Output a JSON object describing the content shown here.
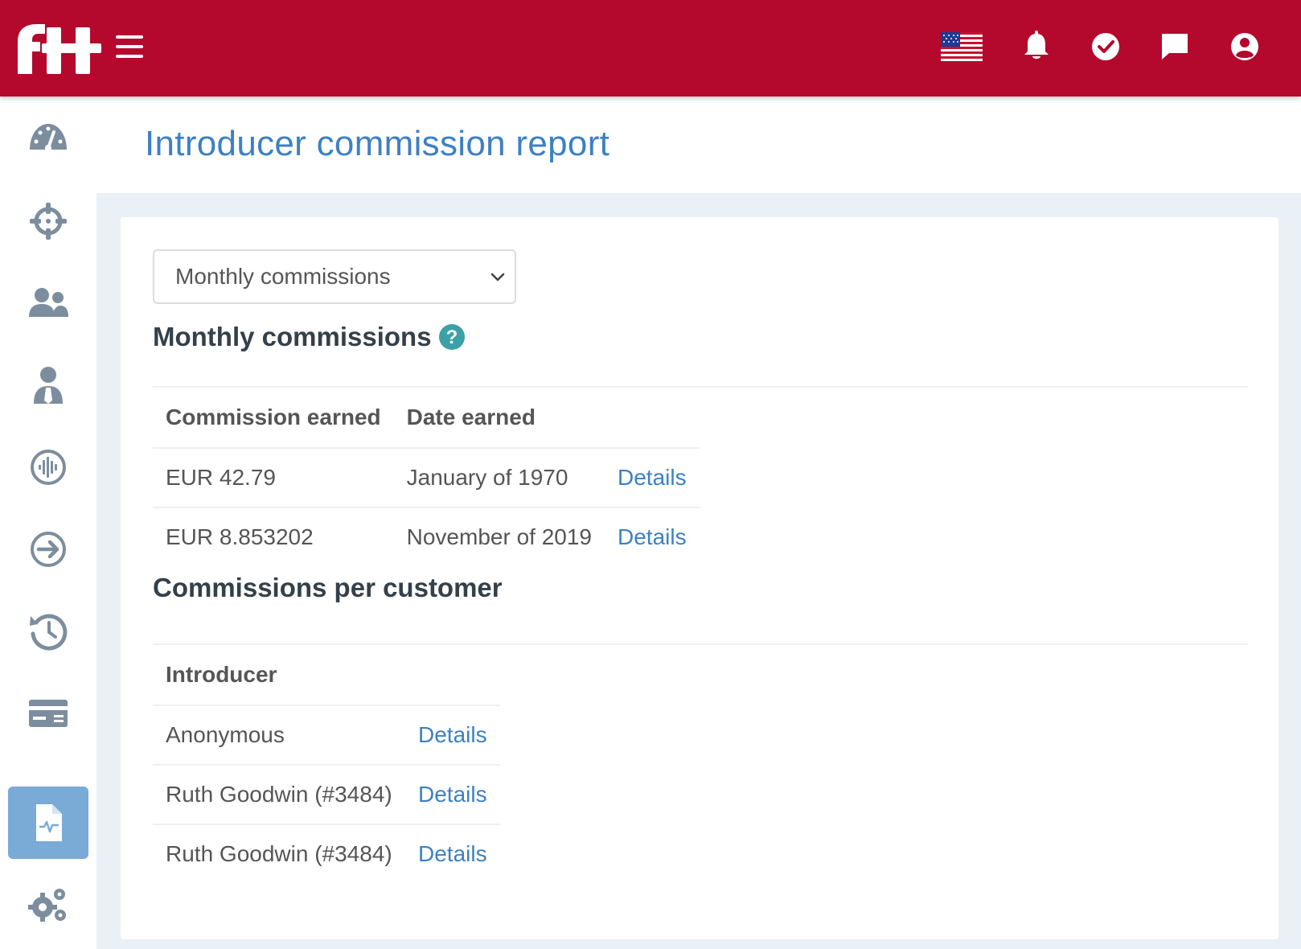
{
  "topbar": {
    "logo_icon": "fh-logo",
    "menu_icon": "hamburger-menu-icon",
    "icons": [
      "us-flag-icon",
      "bell-icon",
      "check-circle-icon",
      "chat-icon",
      "user-circle-icon"
    ],
    "background_color": "#b4082d"
  },
  "sidebar": {
    "items": [
      {
        "icon": "dashboard-gauge-icon",
        "active": false
      },
      {
        "icon": "crosshair-icon",
        "active": false
      },
      {
        "icon": "users-icon",
        "active": false
      },
      {
        "icon": "user-tie-icon",
        "active": false
      },
      {
        "icon": "waveform-circle-icon",
        "active": false
      },
      {
        "icon": "arrow-right-circle-icon",
        "active": false
      },
      {
        "icon": "history-icon",
        "active": false
      },
      {
        "icon": "credit-card-icon",
        "active": false
      },
      {
        "icon": "file-report-icon",
        "active": true
      },
      {
        "icon": "gears-icon",
        "active": false
      }
    ],
    "active_color": "#7aaad6"
  },
  "page": {
    "title": "Introducer commission report"
  },
  "report_select": {
    "selected": "Monthly commissions"
  },
  "monthly": {
    "title": "Monthly commissions",
    "help_icon": "question-circle-icon",
    "headers": [
      "Commission earned",
      "Date earned"
    ],
    "rows": [
      {
        "amount": "EUR 42.79",
        "date": "January of 1970",
        "link": "Details"
      },
      {
        "amount": "EUR 8.853202",
        "date": "November of 2019",
        "link": "Details"
      }
    ]
  },
  "per_customer": {
    "title": "Commissions per customer",
    "headers": [
      "Introducer"
    ],
    "rows": [
      {
        "introducer": "Anonymous",
        "link": "Details"
      },
      {
        "introducer": "Ruth Goodwin (#3484)",
        "link": "Details"
      },
      {
        "introducer": "Ruth Goodwin (#3484)",
        "link": "Details"
      }
    ]
  }
}
